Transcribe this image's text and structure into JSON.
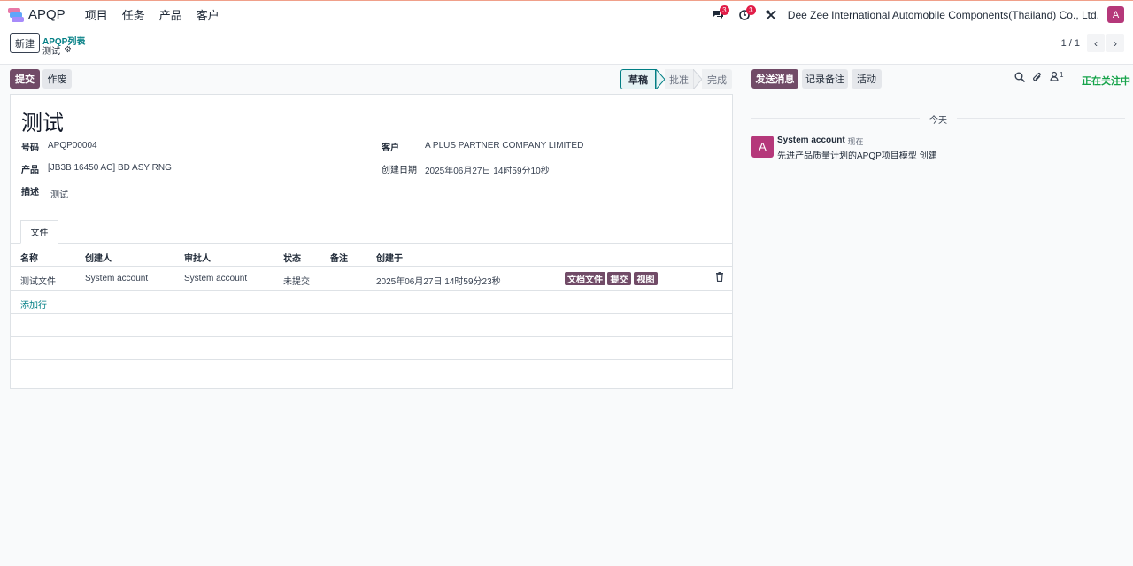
{
  "navbar": {
    "app_name": "APQP",
    "menu": [
      "项目",
      "任务",
      "产品",
      "客户"
    ],
    "messages_count": "3",
    "activities_count": "3",
    "company": "Dee Zee International Automobile Components(Thailand) Co., Ltd.",
    "user_initial": "A"
  },
  "control": {
    "new_label": "新建",
    "breadcrumb_parent": "APQP列表",
    "breadcrumb_current": "测试",
    "pager": "1 / 1"
  },
  "form_actions": {
    "submit_label": "提交",
    "cancel_label": "作废"
  },
  "statusbar": {
    "stages": [
      "草稿",
      "批准",
      "完成"
    ],
    "active": "草稿"
  },
  "record": {
    "title": "测试",
    "number_label": "号码",
    "number": "APQP00004",
    "product_label": "产品",
    "product": "[JB3B 16450 AC] BD ASY RNG",
    "description_label": "描述",
    "description": "测试",
    "customer_label": "客户",
    "customer": "A PLUS PARTNER COMPANY LIMITED",
    "created_label": "创建日期",
    "created": "2025年06月27日 14时59分10秒"
  },
  "tab": {
    "label": "文件"
  },
  "table": {
    "headers": [
      "名称",
      "创建人",
      "审批人",
      "状态",
      "备注",
      "创建于"
    ],
    "rows": [
      {
        "name": "测试文件",
        "creator": "System account",
        "approver": "System account",
        "status": "未提交",
        "note": "",
        "created": "2025年06月27日 14时59分23秒",
        "actions": [
          "文档文件",
          "提交",
          "视图"
        ]
      }
    ],
    "add_line": "添加行"
  },
  "chatter": {
    "send_message": "发送消息",
    "log_note": "记录备注",
    "activity": "活动",
    "followers_count": "1",
    "following": "正在关注中",
    "date_separator": "今天",
    "messages": [
      {
        "author": "System account",
        "time": "- 现在",
        "body": "先进产品质量计划的APQP项目模型 创建",
        "initial": "A"
      }
    ]
  },
  "colors": {
    "primary": "#714b67",
    "link": "#017e84",
    "following": "#16a34a",
    "avatar": "#b5387a",
    "badge": "#e11d48"
  }
}
